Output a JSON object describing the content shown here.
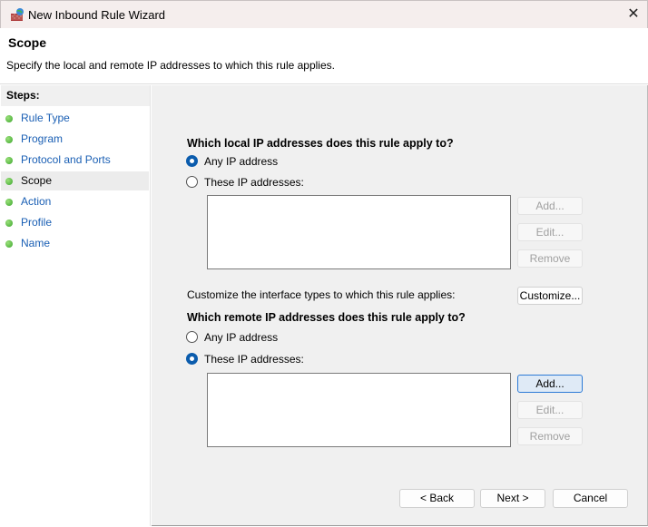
{
  "window": {
    "title": "New Inbound Rule Wizard",
    "close": "✕"
  },
  "header": {
    "title": "Scope",
    "description": "Specify the local and remote IP addresses to which this rule applies."
  },
  "steps": {
    "heading": "Steps:",
    "items": [
      {
        "label": "Rule Type"
      },
      {
        "label": "Program"
      },
      {
        "label": "Protocol and Ports"
      },
      {
        "label": "Scope"
      },
      {
        "label": "Action"
      },
      {
        "label": "Profile"
      },
      {
        "label": "Name"
      }
    ]
  },
  "local": {
    "heading": "Which local IP addresses does this rule apply to?",
    "any": "Any IP address",
    "these": "These IP addresses:",
    "selected": "any",
    "add": "Add...",
    "edit": "Edit...",
    "remove": "Remove"
  },
  "customize": {
    "label": "Customize the interface types to which this rule applies:",
    "button": "Customize..."
  },
  "remote": {
    "heading": "Which remote IP addresses does this rule apply to?",
    "any": "Any IP address",
    "these": "These IP addresses:",
    "selected": "these",
    "add": "Add...",
    "edit": "Edit...",
    "remove": "Remove"
  },
  "footer": {
    "back": "< Back",
    "next": "Next >",
    "cancel": "Cancel"
  }
}
